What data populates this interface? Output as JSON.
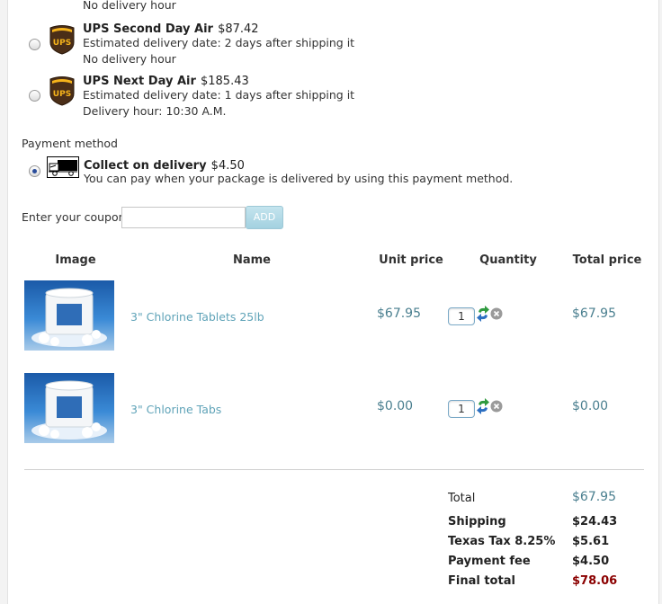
{
  "shipping_partial": {
    "note": "No delivery hour"
  },
  "shipping_options": [
    {
      "name": "UPS Second Day Air",
      "price": "$87.42",
      "estimate": "Estimated delivery date: 2 days after shipping it",
      "hour": "No delivery hour",
      "selected": false
    },
    {
      "name": "UPS Next Day Air",
      "price": "$185.43",
      "estimate": "Estimated delivery date: 1 days after shipping it",
      "hour": "Delivery hour: 10:30 A.M.",
      "selected": false
    }
  ],
  "carrier_logo_text": "UPS",
  "payment": {
    "heading": "Payment method",
    "method": "Collect on delivery",
    "fee": "$4.50",
    "description": "You can pay when your package is delivered by using this payment method.",
    "selected": true
  },
  "coupon": {
    "label": "Enter your coupon",
    "value": "",
    "button": "ADD"
  },
  "cart": {
    "headers": {
      "image": "Image",
      "name": "Name",
      "unit_price": "Unit price",
      "quantity": "Quantity",
      "total_price": "Total price"
    },
    "items": [
      {
        "name": "3\" Chlorine Tablets 25lb",
        "unit_price": "$67.95",
        "quantity": "1",
        "total_price": "$67.95"
      },
      {
        "name": "3\" Chlorine Tabs",
        "unit_price": "$0.00",
        "quantity": "1",
        "total_price": "$0.00"
      }
    ]
  },
  "summary": {
    "total_label": "Total",
    "total_value": "$67.95",
    "shipping_label": "Shipping",
    "shipping_value": "$24.43",
    "tax_label": "Texas Tax 8.25%",
    "tax_value": "$5.61",
    "fee_label": "Payment fee",
    "fee_value": "$4.50",
    "final_label": "Final total",
    "final_value": "$78.06"
  },
  "colors": {
    "accent": "#5fa3b8",
    "price": "#4a7f8f",
    "final_total": "#8b0000",
    "ups_brown": "#4b2e17",
    "ups_gold": "#f5b31b"
  }
}
